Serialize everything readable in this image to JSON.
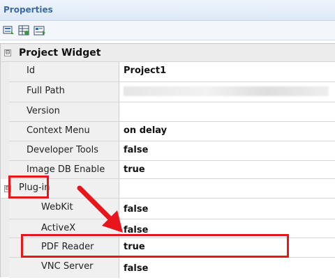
{
  "panel": {
    "title": "Properties"
  },
  "toolbar": {
    "icons": [
      "categorized-view-icon",
      "sort-properties-icon",
      "property-pages-icon"
    ]
  },
  "category": {
    "label": "Project Widget",
    "expander": "⊟"
  },
  "rows": [
    {
      "name": "Id",
      "value": "Project1"
    },
    {
      "name": "Full Path",
      "value": ""
    },
    {
      "name": "Version",
      "value": ""
    },
    {
      "name": "Context Menu",
      "value": "on delay"
    },
    {
      "name": "Developer Tools",
      "value": "false"
    },
    {
      "name": "Image DB Enable",
      "value": "true"
    }
  ],
  "plugin": {
    "label": "Plug-in",
    "expander": "⊟",
    "rows": [
      {
        "name": "WebKit",
        "value": "false"
      },
      {
        "name": "ActiveX",
        "value": "false"
      },
      {
        "name": "PDF Reader",
        "value": "true"
      },
      {
        "name": "VNC Server",
        "value": "false"
      }
    ]
  },
  "colors": {
    "highlight": "#e8161c",
    "title": "#3b6aa8"
  }
}
